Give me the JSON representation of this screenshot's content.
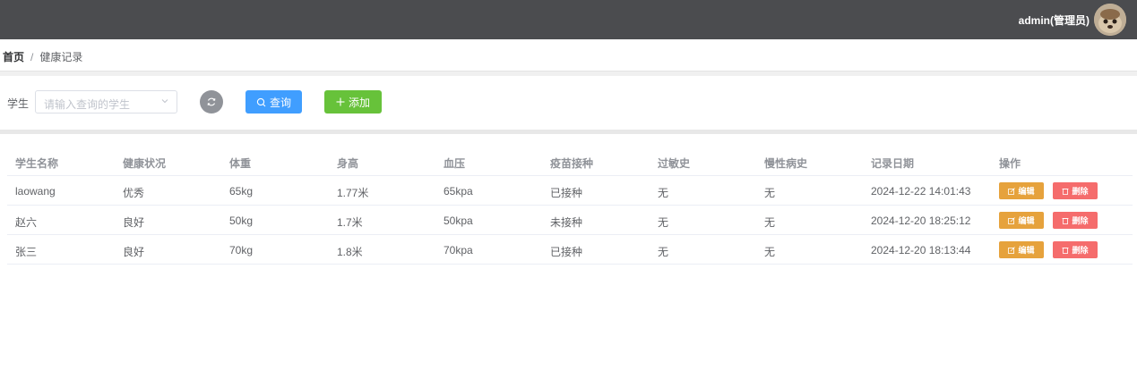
{
  "topbar": {
    "user": "admin(管理员)"
  },
  "breadcrumb": {
    "home": "首页",
    "separator": "/",
    "current": "健康记录"
  },
  "search": {
    "label": "学生",
    "placeholder": "请输入查询的学生",
    "query_label": "查询",
    "add_label": "添加"
  },
  "table": {
    "headers": [
      "学生名称",
      "健康状况",
      "体重",
      "身高",
      "血压",
      "疫苗接种",
      "过敏史",
      "慢性病史",
      "记录日期",
      "操作"
    ],
    "rows": [
      [
        "laowang",
        "优秀",
        "65kg",
        "1.77米",
        "65kpa",
        "已接种",
        "无",
        "无",
        "2024-12-22 14:01:43"
      ],
      [
        "赵六",
        "良好",
        "50kg",
        "1.7米",
        "50kpa",
        "未接种",
        "无",
        "无",
        "2024-12-20 18:25:12"
      ],
      [
        "张三",
        "良好",
        "70kg",
        "1.8米",
        "70kpa",
        "已接种",
        "无",
        "无",
        "2024-12-20 18:13:44"
      ]
    ],
    "edit_label": "编辑",
    "delete_label": "删除"
  },
  "colors": {
    "topbar": "#4b4c4f",
    "primary": "#409eff",
    "success": "#67c23a",
    "warning": "#e6a23c",
    "danger": "#f56c6c"
  },
  "icons": {
    "refresh": "refresh-icon",
    "search": "search-icon",
    "plus": "plus-icon",
    "edit": "edit-icon",
    "delete": "trash-icon",
    "dropdown": "chevron-down-icon"
  }
}
